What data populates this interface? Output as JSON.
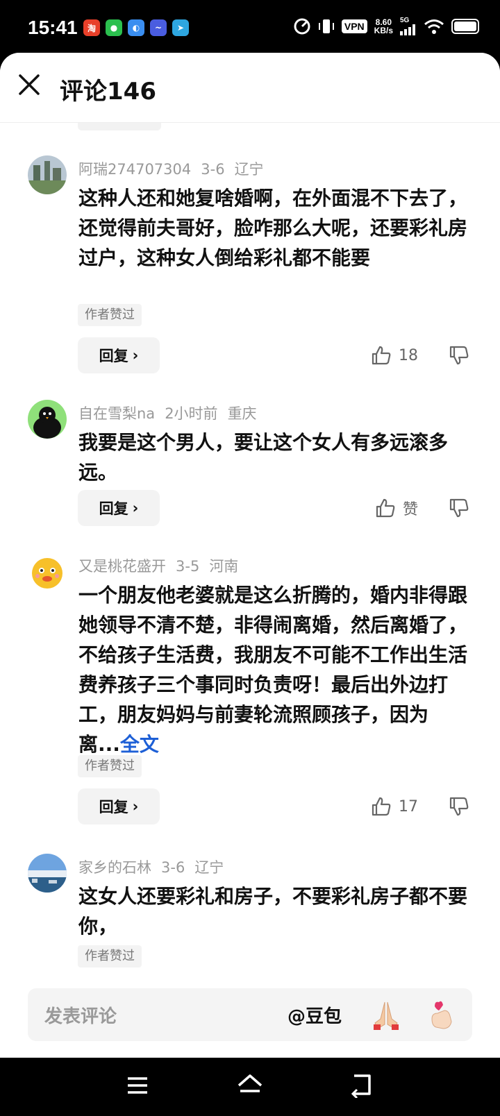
{
  "status": {
    "time": "15:41",
    "vpn": "VPN",
    "speed_value": "8.60",
    "speed_unit": "KB/s",
    "network": "5G"
  },
  "header": {
    "title": "评论146"
  },
  "comments": [
    {
      "user": "阿瑞274707304",
      "date": "3-6",
      "location": "辽宁",
      "text": "这种人还和她复啥婚啊，在外面混不下去了，还觉得前夫哥好，脸咋那么大呢，还要彩礼房过户，这种女人倒给彩礼都不能要",
      "badge": "作者赞过",
      "reply_label": "回复",
      "likes": "18"
    },
    {
      "user": "自在雪梨na",
      "date": "2小时前",
      "location": "重庆",
      "text": "我要是这个男人，要让这个女人有多远滚多远。",
      "reply_label": "回复",
      "likes": "赞"
    },
    {
      "user": "又是桃花盛开",
      "date": "3-5",
      "location": "河南",
      "text": "一个朋友他老婆就是这么折腾的，婚内非得跟她领导不清不楚，非得闹离婚，然后离婚了，不给孩子生活费，我朋友不可能不工作出生活费养孩子三个事同时负责呀！最后出外边打工，朋友妈妈与前妻轮流照顾孩子，因为离...",
      "more": "全文",
      "badge": "作者赞过",
      "reply_label": "回复",
      "likes": "17"
    },
    {
      "user": "家乡的石林",
      "date": "3-6",
      "location": "辽宁",
      "text": "这女人还要彩礼和房子，不要彩礼房子都不要你，",
      "badge": "作者赞过"
    }
  ],
  "input": {
    "placeholder": "发表评论",
    "mention": "@豆包"
  }
}
